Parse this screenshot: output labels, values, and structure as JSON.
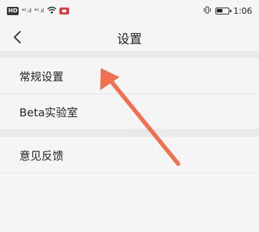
{
  "status_bar": {
    "hd_label": "HD",
    "signal_1": "⁴ᴳ.ıl",
    "signal_2": "⁴ᴳ.ıl",
    "wifi_icon": "wifi-icon",
    "time": "1:06",
    "battery_level": 0.55
  },
  "nav": {
    "title": "设置",
    "back_icon": "chevron-left-icon"
  },
  "settings": {
    "items": [
      {
        "label": "常规设置"
      },
      {
        "label": "Beta实验室"
      },
      {
        "label": "意见反馈"
      }
    ]
  },
  "annotation": {
    "arrow_color": "#f07050"
  }
}
